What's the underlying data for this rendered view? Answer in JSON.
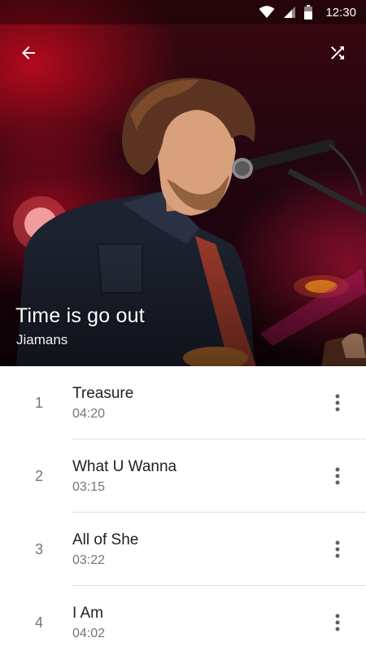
{
  "status_bar": {
    "time": "12:30",
    "icons": [
      "wifi-icon",
      "signal-icon",
      "battery-icon"
    ]
  },
  "app_bar": {
    "back_icon": "arrow-back-icon",
    "shuffle_icon": "shuffle-icon"
  },
  "album": {
    "title": "Time is go out",
    "artist": "Jiamans"
  },
  "tracks": [
    {
      "number": "1",
      "title": "Treasure",
      "duration": "04:20"
    },
    {
      "number": "2",
      "title": "What U Wanna",
      "duration": "03:15"
    },
    {
      "number": "3",
      "title": "All of She",
      "duration": "03:22"
    },
    {
      "number": "4",
      "title": "I Am",
      "duration": "04:02"
    }
  ],
  "colors": {
    "primary_text": "#212121",
    "secondary_text": "#757575",
    "divider": "#e0e0e0",
    "icon": "#616161"
  }
}
